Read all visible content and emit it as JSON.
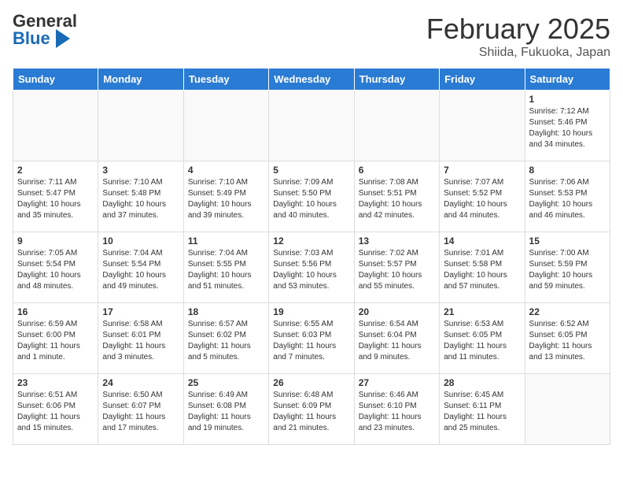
{
  "header": {
    "logo_general": "General",
    "logo_blue": "Blue",
    "month_year": "February 2025",
    "location": "Shiida, Fukuoka, Japan"
  },
  "weekdays": [
    "Sunday",
    "Monday",
    "Tuesday",
    "Wednesday",
    "Thursday",
    "Friday",
    "Saturday"
  ],
  "weeks": [
    [
      {
        "day": "",
        "info": ""
      },
      {
        "day": "",
        "info": ""
      },
      {
        "day": "",
        "info": ""
      },
      {
        "day": "",
        "info": ""
      },
      {
        "day": "",
        "info": ""
      },
      {
        "day": "",
        "info": ""
      },
      {
        "day": "1",
        "info": "Sunrise: 7:12 AM\nSunset: 5:46 PM\nDaylight: 10 hours and 34 minutes."
      }
    ],
    [
      {
        "day": "2",
        "info": "Sunrise: 7:11 AM\nSunset: 5:47 PM\nDaylight: 10 hours and 35 minutes."
      },
      {
        "day": "3",
        "info": "Sunrise: 7:10 AM\nSunset: 5:48 PM\nDaylight: 10 hours and 37 minutes."
      },
      {
        "day": "4",
        "info": "Sunrise: 7:10 AM\nSunset: 5:49 PM\nDaylight: 10 hours and 39 minutes."
      },
      {
        "day": "5",
        "info": "Sunrise: 7:09 AM\nSunset: 5:50 PM\nDaylight: 10 hours and 40 minutes."
      },
      {
        "day": "6",
        "info": "Sunrise: 7:08 AM\nSunset: 5:51 PM\nDaylight: 10 hours and 42 minutes."
      },
      {
        "day": "7",
        "info": "Sunrise: 7:07 AM\nSunset: 5:52 PM\nDaylight: 10 hours and 44 minutes."
      },
      {
        "day": "8",
        "info": "Sunrise: 7:06 AM\nSunset: 5:53 PM\nDaylight: 10 hours and 46 minutes."
      }
    ],
    [
      {
        "day": "9",
        "info": "Sunrise: 7:05 AM\nSunset: 5:54 PM\nDaylight: 10 hours and 48 minutes."
      },
      {
        "day": "10",
        "info": "Sunrise: 7:04 AM\nSunset: 5:54 PM\nDaylight: 10 hours and 49 minutes."
      },
      {
        "day": "11",
        "info": "Sunrise: 7:04 AM\nSunset: 5:55 PM\nDaylight: 10 hours and 51 minutes."
      },
      {
        "day": "12",
        "info": "Sunrise: 7:03 AM\nSunset: 5:56 PM\nDaylight: 10 hours and 53 minutes."
      },
      {
        "day": "13",
        "info": "Sunrise: 7:02 AM\nSunset: 5:57 PM\nDaylight: 10 hours and 55 minutes."
      },
      {
        "day": "14",
        "info": "Sunrise: 7:01 AM\nSunset: 5:58 PM\nDaylight: 10 hours and 57 minutes."
      },
      {
        "day": "15",
        "info": "Sunrise: 7:00 AM\nSunset: 5:59 PM\nDaylight: 10 hours and 59 minutes."
      }
    ],
    [
      {
        "day": "16",
        "info": "Sunrise: 6:59 AM\nSunset: 6:00 PM\nDaylight: 11 hours and 1 minute."
      },
      {
        "day": "17",
        "info": "Sunrise: 6:58 AM\nSunset: 6:01 PM\nDaylight: 11 hours and 3 minutes."
      },
      {
        "day": "18",
        "info": "Sunrise: 6:57 AM\nSunset: 6:02 PM\nDaylight: 11 hours and 5 minutes."
      },
      {
        "day": "19",
        "info": "Sunrise: 6:55 AM\nSunset: 6:03 PM\nDaylight: 11 hours and 7 minutes."
      },
      {
        "day": "20",
        "info": "Sunrise: 6:54 AM\nSunset: 6:04 PM\nDaylight: 11 hours and 9 minutes."
      },
      {
        "day": "21",
        "info": "Sunrise: 6:53 AM\nSunset: 6:05 PM\nDaylight: 11 hours and 11 minutes."
      },
      {
        "day": "22",
        "info": "Sunrise: 6:52 AM\nSunset: 6:05 PM\nDaylight: 11 hours and 13 minutes."
      }
    ],
    [
      {
        "day": "23",
        "info": "Sunrise: 6:51 AM\nSunset: 6:06 PM\nDaylight: 11 hours and 15 minutes."
      },
      {
        "day": "24",
        "info": "Sunrise: 6:50 AM\nSunset: 6:07 PM\nDaylight: 11 hours and 17 minutes."
      },
      {
        "day": "25",
        "info": "Sunrise: 6:49 AM\nSunset: 6:08 PM\nDaylight: 11 hours and 19 minutes."
      },
      {
        "day": "26",
        "info": "Sunrise: 6:48 AM\nSunset: 6:09 PM\nDaylight: 11 hours and 21 minutes."
      },
      {
        "day": "27",
        "info": "Sunrise: 6:46 AM\nSunset: 6:10 PM\nDaylight: 11 hours and 23 minutes."
      },
      {
        "day": "28",
        "info": "Sunrise: 6:45 AM\nSunset: 6:11 PM\nDaylight: 11 hours and 25 minutes."
      },
      {
        "day": "",
        "info": ""
      }
    ]
  ]
}
